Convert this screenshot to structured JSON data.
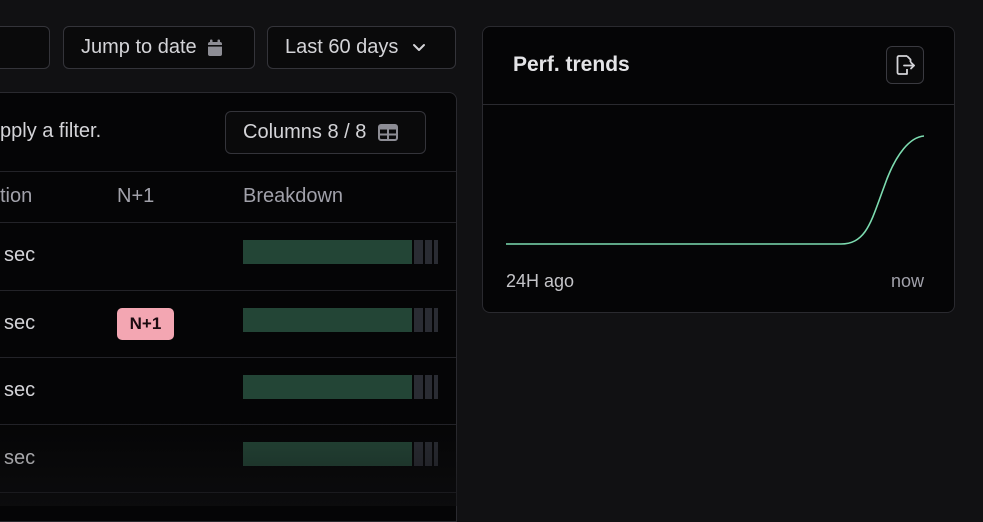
{
  "toolbar": {
    "jump_to_date_label": "Jump to date",
    "range_label": "Last 60 days"
  },
  "table": {
    "filter_hint": "pply a filter.",
    "columns_button_label": "Columns 8 / 8",
    "headers": {
      "duration": "tion",
      "n_plus_one": "N+1",
      "breakdown": "Breakdown"
    },
    "rows": [
      {
        "duration": "sec",
        "badge": "",
        "breakdown_fraction": 0.86
      },
      {
        "duration": "sec",
        "badge": "N+1",
        "breakdown_fraction": 0.86
      },
      {
        "duration": "sec",
        "badge": "",
        "breakdown_fraction": 0.86
      },
      {
        "duration": "sec",
        "badge": "",
        "breakdown_fraction": 0.86
      }
    ]
  },
  "perf_panel": {
    "title": "Perf. trends",
    "x_start_label": "24H ago",
    "x_end_label": "now"
  },
  "colors": {
    "accent_line": "#7ddcb0",
    "badge_bg": "#f3a6b2",
    "breakdown_bar": "#234536"
  }
}
